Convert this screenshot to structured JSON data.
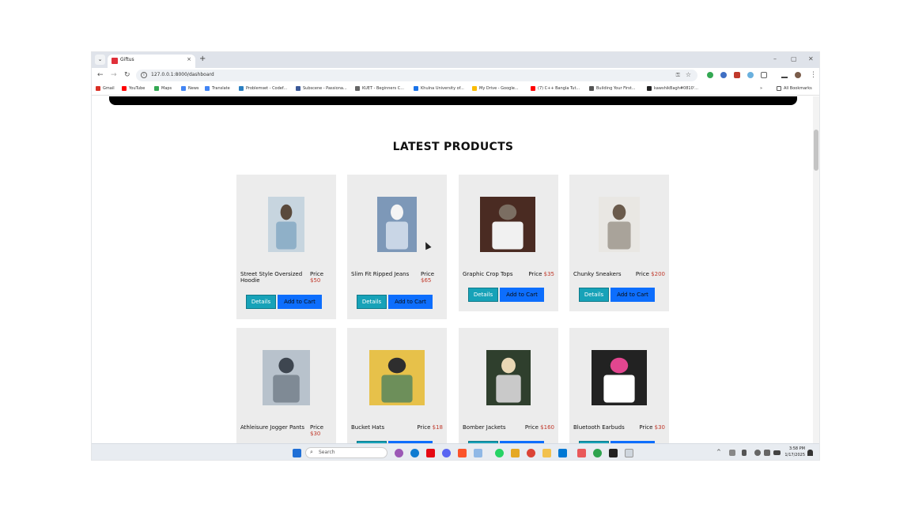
{
  "browser": {
    "tab_title": "Giftus",
    "url": "127.0.0.1:8000/dashboard",
    "new_tab": "+",
    "close": "×",
    "min": "–",
    "max": "▢",
    "win_close": "✕"
  },
  "bookmarks": [
    {
      "label": "Gmail",
      "color": "#d93025"
    },
    {
      "label": "YouTube",
      "color": "#ff0000"
    },
    {
      "label": "Maps",
      "color": "#34a853"
    },
    {
      "label": "News",
      "color": "#4285f4"
    },
    {
      "label": "Translate",
      "color": "#4285f4"
    },
    {
      "label": "Problemset - Codef...",
      "color": "#2a7fc1"
    },
    {
      "label": "Subscene - Passiona...",
      "color": "#3b5998"
    },
    {
      "label": "KUET - Beginners C...",
      "color": "#666666"
    },
    {
      "label": "Khulna University of...",
      "color": "#1a73e8"
    },
    {
      "label": "My Drive - Google...",
      "color": "#fbbc04"
    },
    {
      "label": "(7) C++ Bangla Tut...",
      "color": "#ff0000"
    },
    {
      "label": "Building Your First...",
      "color": "#555555"
    },
    {
      "label": "kawshikBagh#0810'...",
      "color": "#222222"
    }
  ],
  "all_bookmarks": "All Bookmarks",
  "page": {
    "section_title": "LATEST PRODUCTS",
    "details_label": "Details",
    "cart_label": "Add to Cart",
    "price_label": "Price"
  },
  "products": [
    {
      "name": "Street Style Oversized Hoodie",
      "price": "$50",
      "image": "hoodie-photo"
    },
    {
      "name": "Slim Fit Ripped Jeans",
      "price": "$65",
      "image": "jeans-photo"
    },
    {
      "name": "Graphic Crop Tops",
      "price": "$35",
      "image": "crop-top-photo"
    },
    {
      "name": "Chunky Sneakers",
      "price": "$200",
      "image": "sneakers-photo"
    },
    {
      "name": "Athleisure Jogger Pants",
      "price": "$30",
      "image": "jogger-photo"
    },
    {
      "name": "Bucket Hats",
      "price": "$18",
      "image": "bucket-hat-photo"
    },
    {
      "name": "Bomber Jackets",
      "price": "$160",
      "image": "bomber-photo"
    },
    {
      "name": "Bluetooth Earbuds",
      "price": "$30",
      "image": "earbuds-photo"
    }
  ],
  "taskbar": {
    "search_placeholder": "Search",
    "time": "3:58 PM",
    "date": "1/17/2025"
  }
}
